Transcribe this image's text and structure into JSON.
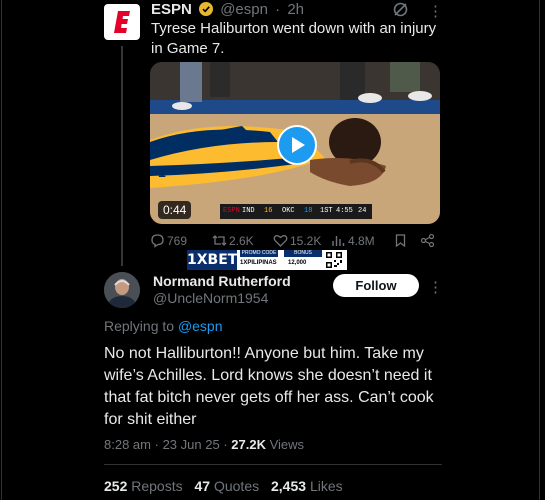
{
  "original_tweet": {
    "author_name": "ESPN",
    "handle": "@espn",
    "separator": "·",
    "time": "2h",
    "text": "Tyrese Haliburton went down with an injury in Game 7.",
    "video": {
      "duration": "0:44",
      "scorebug": {
        "team_a": "IND",
        "score_a": "16",
        "team_b": "OKC",
        "score_b": "18",
        "quarter": "1ST",
        "clock": "4:55",
        "shot_clock": "24",
        "network": "ESPN"
      }
    },
    "actions": {
      "replies": "769",
      "reposts": "2.6K",
      "likes": "15.2K",
      "views": "4.8M"
    }
  },
  "ad_banner": {
    "brand": "1XBET",
    "promo_label": "PROMO CODE",
    "promo_code": "1XPILIPINAS",
    "bonus_label": "BONUS",
    "bonus_amount": "12,000"
  },
  "reply": {
    "author_name": "Normand Rutherford",
    "handle": "@UncleNorm1954",
    "follow_label": "Follow",
    "replying_prefix": "Replying to",
    "replying_to": "@espn",
    "text": "No not Halliburton!! Anyone but him. Take my wife’s Achilles. Lord knows she doesn’t need it that fat bitch never gets off her ass. Can’t cook for shit either",
    "time": "8:28 am",
    "date": "23 Jun 25",
    "views_count": "27.2K",
    "views_label": "Views",
    "dot": "·"
  },
  "stats": {
    "reposts_count": "252",
    "reposts_label": "Reposts",
    "quotes_count": "47",
    "quotes_label": "Quotes",
    "likes_count": "2,453",
    "likes_label": "Likes"
  },
  "colors": {
    "background": "#000000",
    "text": "#e7e9ea",
    "muted": "#71767b",
    "accent": "#1d9bf0",
    "espn_red": "#e4002b",
    "pacers_gold": "#fdbb30",
    "pacers_navy": "#002d62"
  }
}
